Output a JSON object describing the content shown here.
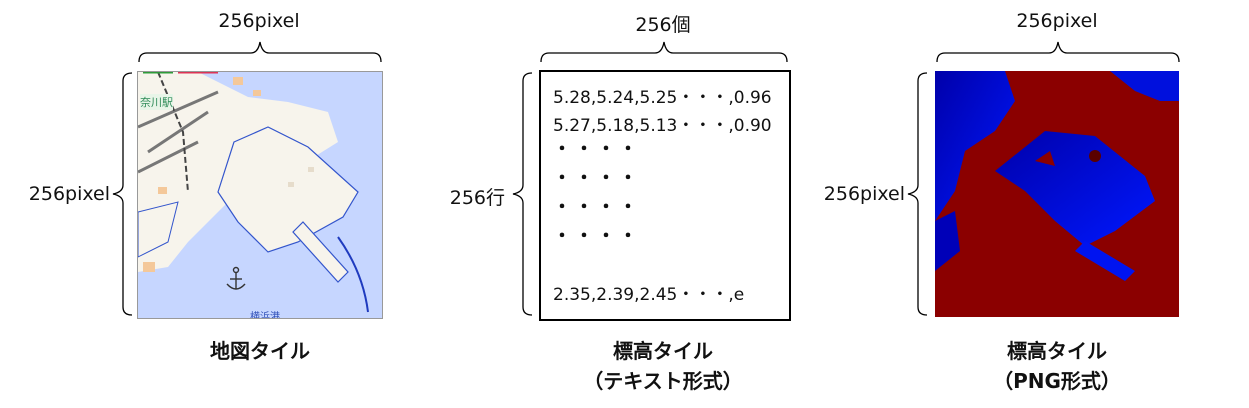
{
  "map_tile": {
    "top_label": "256pixel",
    "side_label": "256pixel",
    "caption": "地図タイル",
    "map_station_label": "奈川駅",
    "map_bottom_label": "横浜港"
  },
  "text_tile": {
    "top_label": "256個",
    "side_label": "256行",
    "caption_line1": "標高タイル",
    "caption_line2": "（テキスト形式）",
    "lines": [
      "5.28,5.24,5.25・・・,0.96",
      "5.27,5.18,5.13・・・,0.90",
      "・・・・",
      "・・・・",
      "・・・・",
      "・・・・",
      "2.35,2.39,2.45・・・,e"
    ]
  },
  "png_tile": {
    "top_label": "256pixel",
    "side_label": "256pixel",
    "caption_line1": "標高タイル",
    "caption_line2": "（PNG形式）"
  },
  "colors": {
    "water": "#c6d6ff",
    "land": "#f7f4ec",
    "elevation_high": "#8b0000",
    "elevation_low": "#0000c8"
  }
}
